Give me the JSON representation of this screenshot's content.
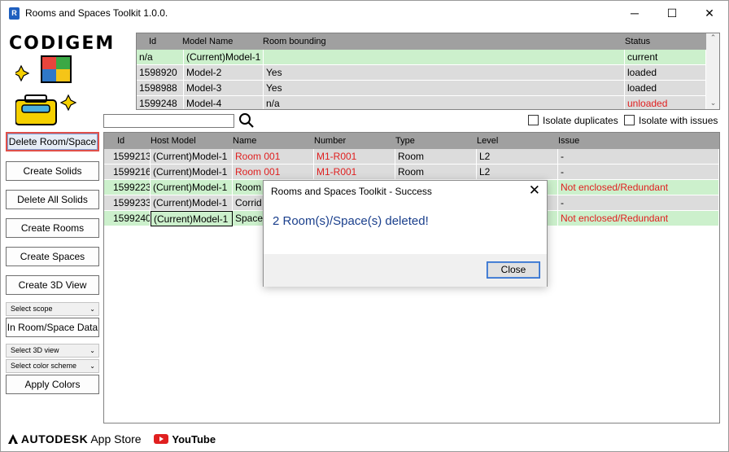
{
  "window": {
    "title": "Rooms and Spaces Toolkit 1.0.0.",
    "app_icon": "R",
    "minimize": "─",
    "maximize": "☐",
    "close": "✕"
  },
  "logo": {
    "text": "CODIGEM"
  },
  "sidebar": {
    "buttons": [
      "Delete Room/Space",
      "Create Solids",
      "Delete All Solids",
      "Create Rooms",
      "Create Spaces",
      "Create 3D View"
    ],
    "scope_select": "Select scope",
    "data_button": "In Room/Space Data",
    "view_select": "Select 3D view",
    "color_select": "Select color scheme",
    "apply_button": "Apply Colors"
  },
  "models": {
    "headers": [
      "Id",
      "Model Name",
      "Room bounding",
      "Status"
    ],
    "rows": [
      {
        "id": "n/a",
        "name": "(Current)Model-1",
        "bounding": "",
        "status": "current",
        "bg": "#ccf0cc",
        "status_red": false
      },
      {
        "id": "1598920",
        "name": "Model-2",
        "bounding": "Yes",
        "status": "loaded",
        "bg": "#dcdcdc",
        "status_red": false
      },
      {
        "id": "1598988",
        "name": "Model-3",
        "bounding": "Yes",
        "status": "loaded",
        "bg": "#dcdcdc",
        "status_red": false
      },
      {
        "id": "1599248",
        "name": "Model-4",
        "bounding": "n/a",
        "status": "unloaded",
        "bg": "#dcdcdc",
        "status_red": true
      }
    ]
  },
  "filters": {
    "search_value": "",
    "isolate_duplicates": "Isolate duplicates",
    "isolate_issues": "Isolate with issues"
  },
  "rooms": {
    "headers": [
      "Id",
      "Host Model",
      "Name",
      "Number",
      "Type",
      "Level",
      "Issue"
    ],
    "rows": [
      {
        "id": "1599213",
        "host": "(Current)Model-1",
        "name": "Room 001",
        "number": "M1-R001",
        "type": "Room",
        "level": "L2",
        "issue": "-",
        "bg": "#dcdcdc",
        "name_red": true,
        "issue_red": false
      },
      {
        "id": "1599216",
        "host": "(Current)Model-1",
        "name": "Room 001",
        "number": "M1-R001",
        "type": "Room",
        "level": "L2",
        "issue": "-",
        "bg": "#dcdcdc",
        "name_red": true,
        "issue_red": false
      },
      {
        "id": "1599223",
        "host": "(Current)Model-1",
        "name": "Room",
        "number": "",
        "type": "",
        "level": "",
        "issue": "Not enclosed/Redundant",
        "bg": "#ccf0cc",
        "name_red": false,
        "issue_red": true
      },
      {
        "id": "1599233",
        "host": "(Current)Model-1",
        "name": "Corrid",
        "number": "",
        "type": "",
        "level": "",
        "issue": "-",
        "bg": "#dcdcdc",
        "name_red": false,
        "issue_red": false
      },
      {
        "id": "1599240",
        "host": "(Current)Model-1",
        "name": "Space",
        "number": "",
        "type": "",
        "level": "",
        "issue": "Not enclosed/Redundant",
        "bg": "#ccf0cc",
        "name_red": false,
        "issue_red": true
      }
    ]
  },
  "dialog": {
    "title": "Rooms and Spaces Toolkit - Success",
    "message": "2 Room(s)/Space(s) deleted!",
    "close_button": "Close",
    "close_icon": "✕"
  },
  "footer": {
    "autodesk": "AUTODESK",
    "app_store": "App Store",
    "youtube": "YouTube"
  }
}
